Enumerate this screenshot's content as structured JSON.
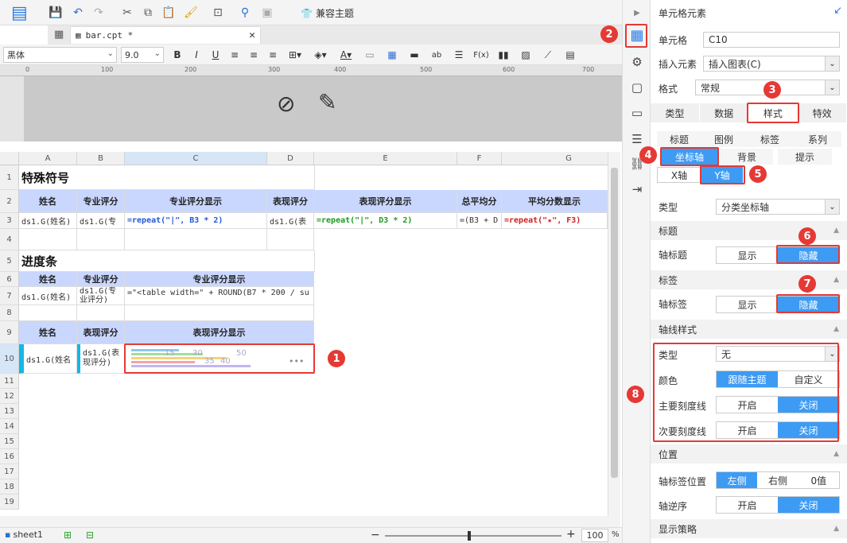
{
  "toolbar": {
    "compat_theme": "兼容主题",
    "font_family": "黑体",
    "font_size": "9.0"
  },
  "file_tab": {
    "name": "bar.cpt *"
  },
  "ruler_marks": [
    "0",
    "100",
    "200",
    "300",
    "400",
    "500",
    "600",
    "700"
  ],
  "columns": [
    "A",
    "B",
    "C",
    "D",
    "E",
    "F",
    "G"
  ],
  "rows": [
    "1",
    "2",
    "3",
    "4",
    "5",
    "6",
    "7",
    "8",
    "9",
    "10",
    "11",
    "12",
    "13",
    "14",
    "15",
    "16",
    "17",
    "18",
    "19"
  ],
  "grid": {
    "r1": {
      "title": "特殊符号"
    },
    "r2": {
      "a": "姓名",
      "b": "专业评分",
      "c": "专业评分显示",
      "d": "表现评分",
      "e": "表现评分显示",
      "f": "总平均分",
      "g": "平均分数显示"
    },
    "r3": {
      "a": "ds1.G(姓名)",
      "b": "ds1.G(专",
      "c": "=repeat(\"|\", B3 * 2)",
      "d": "ds1.G(表",
      "e": "=repeat(\"|\", D3 * 2)",
      "f": "=(B3 + D",
      "g": "=repeat(\"★\", F3)"
    },
    "r5": {
      "title": "进度条"
    },
    "r6": {
      "a": "姓名",
      "b": "专业评分",
      "c": "专业评分显示"
    },
    "r7": {
      "a": "ds1.G(姓名)",
      "b": "ds1.G(专\n业评分)",
      "c": "=\"<table width=\" + ROUND(B7 * 200 / su"
    },
    "r9": {
      "a": "姓名",
      "b": "表现评分",
      "c": "表现评分显示"
    },
    "r10": {
      "a": "ds1.G(姓名",
      "b": "ds1.G(表\n现评分)",
      "chart_labels": [
        "15",
        "30",
        "35",
        "40",
        "50"
      ],
      "more": "•••"
    }
  },
  "status": {
    "sheet": "sheet1",
    "zoom": "100",
    "zoom_unit": "%"
  },
  "panel": {
    "header": "单元格元素",
    "cell_label": "单元格",
    "cell_value": "C10",
    "insert_label": "插入元素",
    "insert_value": "插入图表(C)",
    "format_label": "格式",
    "format_value": "常规",
    "tabs": [
      "类型",
      "数据",
      "样式",
      "特效"
    ],
    "subtabs_row1": [
      "标题",
      "图例",
      "标签",
      "系列"
    ],
    "subtabs_row2": [
      "坐标轴",
      "背景",
      "提示"
    ],
    "axis_tabs": [
      "X轴",
      "Y轴"
    ],
    "type_label": "类型",
    "type_value": "分类坐标轴",
    "sect_title": "标题",
    "axis_title_label": "轴标题",
    "show": "显示",
    "hide": "隐藏",
    "sect_label": "标签",
    "axis_label_label": "轴标签",
    "sect_line": "轴线样式",
    "line_type_label": "类型",
    "line_type_value": "无",
    "color_label": "颜色",
    "follow_theme": "跟随主题",
    "custom": "自定义",
    "major_tick_label": "主要刻度线",
    "minor_tick_label": "次要刻度线",
    "on": "开启",
    "off": "关闭",
    "sect_position": "位置",
    "label_pos_label": "轴标签位置",
    "left": "左侧",
    "right": "右侧",
    "zero": "0值",
    "reverse_label": "轴逆序",
    "sect_display": "显示策略"
  },
  "badges": [
    "1",
    "2",
    "3",
    "4",
    "5",
    "6",
    "7",
    "8"
  ],
  "colors": {
    "accent": "#3d9bf4",
    "annotation": "#e53935",
    "header_fill": "#c9d7ff"
  }
}
